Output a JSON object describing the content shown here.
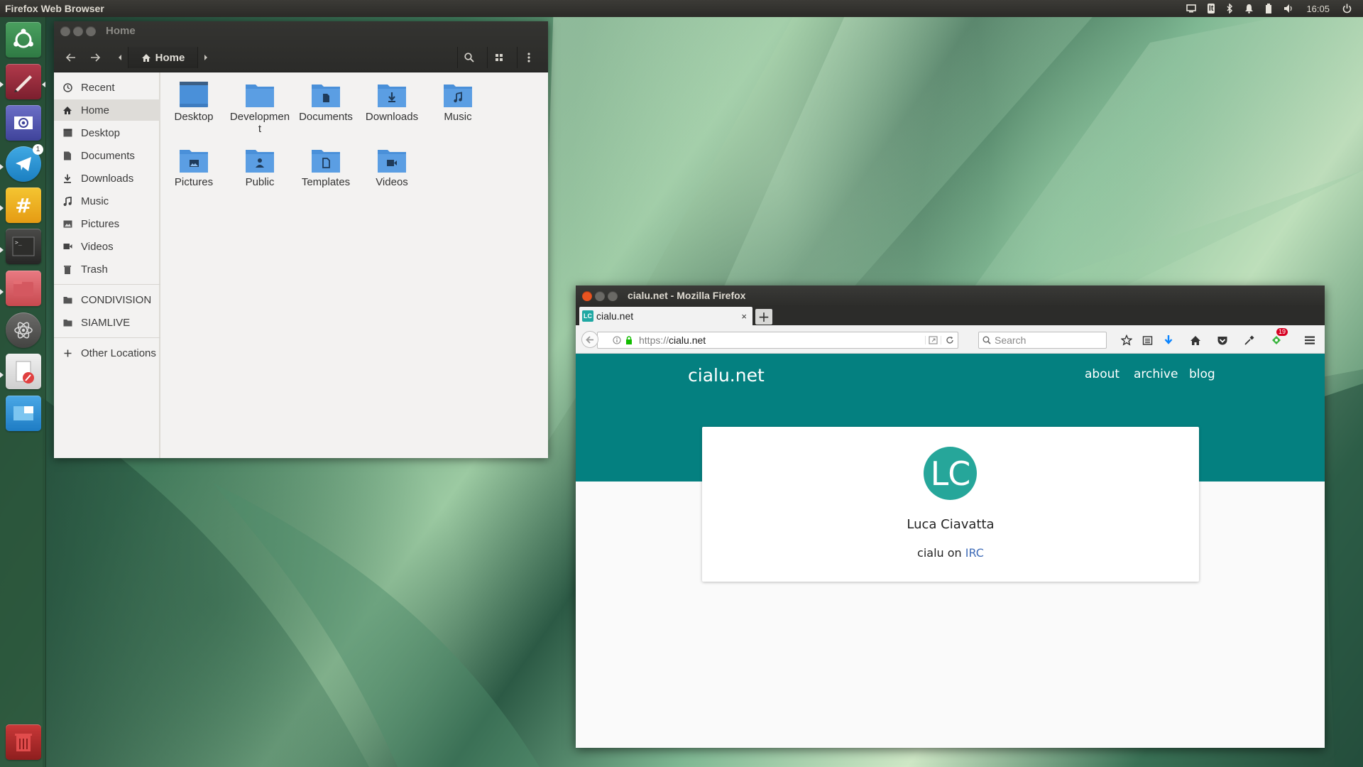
{
  "panel": {
    "title": "Firefox Web Browser",
    "clock": "16:05",
    "indicators": [
      "display-icon",
      "keyboard-layout-icon",
      "bluetooth-icon",
      "notification-bell-icon",
      "battery-icon",
      "volume-icon",
      "power-icon"
    ],
    "keyboard_label": "It"
  },
  "launcher": {
    "items": [
      {
        "name": "ubuntu-dash",
        "icon": "ubuntu-logo-icon"
      },
      {
        "name": "firefox",
        "icon": "pen-app-icon"
      },
      {
        "name": "email",
        "icon": "mail-at-icon"
      },
      {
        "name": "telegram",
        "icon": "telegram-icon",
        "badge": "1"
      },
      {
        "name": "hexchat",
        "icon": "hash-chat-icon"
      },
      {
        "name": "terminal",
        "icon": "terminal-icon"
      },
      {
        "name": "files",
        "icon": "file-manager-icon"
      },
      {
        "name": "atom",
        "icon": "atom-icon"
      },
      {
        "name": "text-editor",
        "icon": "text-editor-icon"
      },
      {
        "name": "workspace-switcher",
        "icon": "workspace-icon"
      },
      {
        "name": "trash",
        "icon": "trash-icon"
      }
    ],
    "telegram_badge": "1"
  },
  "nautilus": {
    "title": "Home",
    "path_current": "Home",
    "sidebar": [
      {
        "label": "Recent",
        "icon": "clock-icon"
      },
      {
        "label": "Home",
        "icon": "home-icon",
        "active": true
      },
      {
        "label": "Desktop",
        "icon": "desktop-icon"
      },
      {
        "label": "Documents",
        "icon": "document-icon"
      },
      {
        "label": "Downloads",
        "icon": "download-icon"
      },
      {
        "label": "Music",
        "icon": "music-note-icon"
      },
      {
        "label": "Pictures",
        "icon": "picture-icon"
      },
      {
        "label": "Videos",
        "icon": "video-icon"
      },
      {
        "label": "Trash",
        "icon": "trash-icon"
      }
    ],
    "bookmarks": [
      {
        "label": "CONDIVISION",
        "icon": "folder-icon"
      },
      {
        "label": "SIAMLIVE",
        "icon": "folder-icon"
      }
    ],
    "other_locations": "Other Locations",
    "folders": [
      {
        "label": "Desktop",
        "icon": "desktop-folder-icon"
      },
      {
        "label": "Development",
        "icon": "folder-icon"
      },
      {
        "label": "Documents",
        "icon": "documents-folder-icon"
      },
      {
        "label": "Downloads",
        "icon": "downloads-folder-icon"
      },
      {
        "label": "Music",
        "icon": "music-folder-icon"
      },
      {
        "label": "Pictures",
        "icon": "pictures-folder-icon"
      },
      {
        "label": "Public",
        "icon": "public-folder-icon"
      },
      {
        "label": "Templates",
        "icon": "templates-folder-icon"
      },
      {
        "label": "Videos",
        "icon": "videos-folder-icon"
      }
    ]
  },
  "firefox": {
    "window_title": "cialu.net - Mozilla Firefox",
    "tab": {
      "title": "cialu.net",
      "favicon_text": "LC",
      "close": "×"
    },
    "newtab": "+",
    "url_protocol": "https://",
    "url_host": "cialu.net",
    "search_placeholder": "Search",
    "addon_badge": "19",
    "page": {
      "brand": "cialu.net",
      "nav": [
        "about",
        "archive",
        "blog"
      ],
      "avatar_initials": "LC",
      "name": "Luca Ciavatta",
      "tagline_prefix": "cialu on",
      "tagline_link": "IRC",
      "header_color": "#048080",
      "avatar_color": "#26a69a"
    }
  }
}
